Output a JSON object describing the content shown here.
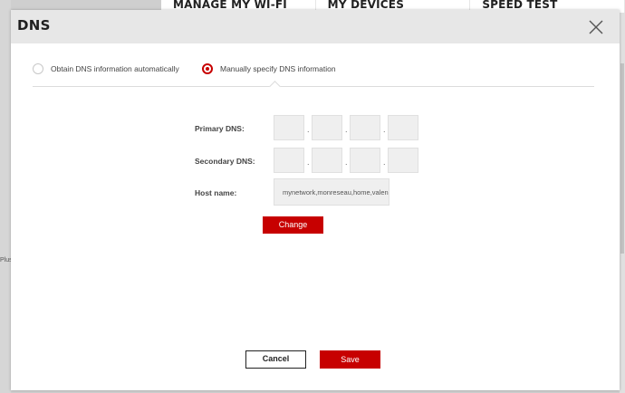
{
  "background": {
    "nav_items": [
      "MANAGE MY WI-FI",
      "MY DEVICES",
      "SPEED TEST"
    ],
    "left_text": "Plus"
  },
  "modal": {
    "title": "DNS",
    "close_icon": "close-x-icon",
    "options": [
      {
        "label": "Obtain DNS information automatically",
        "checked": false
      },
      {
        "label": "Manually specify DNS information",
        "checked": true
      }
    ],
    "primary_dns_label": "Primary DNS:",
    "secondary_dns_label": "Secondary DNS:",
    "host_name_label": "Host name:",
    "host_name_value": "mynetwork,monreseau,home,valen",
    "ip_separator": ".",
    "change_button": "Change",
    "cancel_button": "Cancel",
    "save_button": "Save"
  },
  "colors": {
    "accent": "#c70000",
    "header_bg": "#e7e7e7",
    "input_bg": "#efefef"
  }
}
